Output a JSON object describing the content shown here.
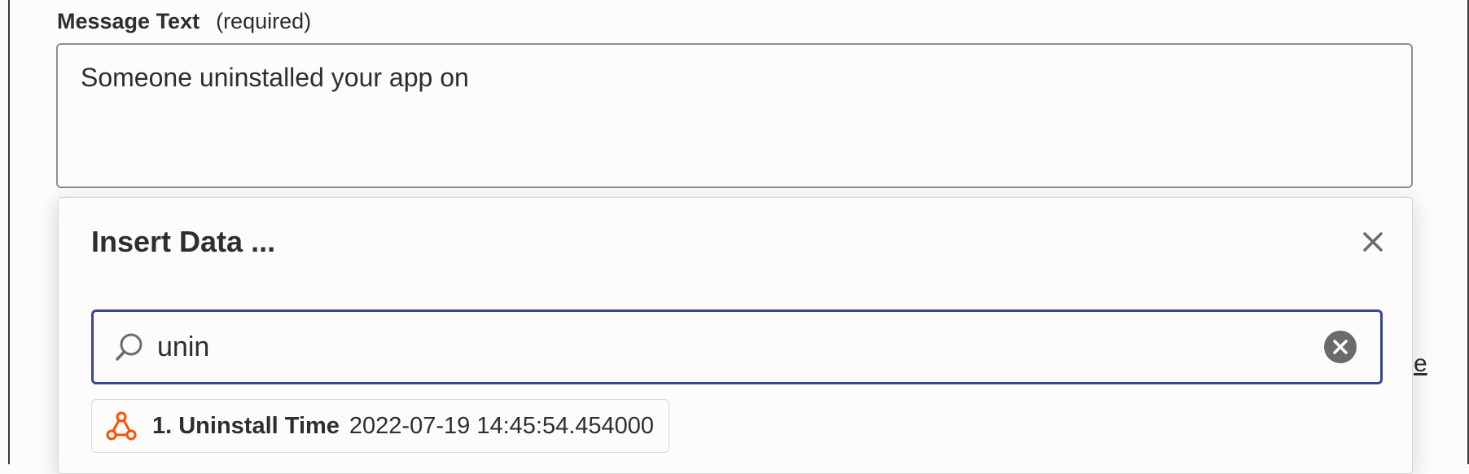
{
  "message_field": {
    "label": "Message Text",
    "required_tag": "(required)",
    "value": "Someone uninstalled your app on"
  },
  "insert_data": {
    "title": "Insert Data ...",
    "close_icon": "close-icon",
    "search": {
      "icon": "search-icon",
      "value": "unin",
      "clear_icon": "clear-circle-icon"
    },
    "results": [
      {
        "icon": "webhook-icon",
        "label": "1. Uninstall Time",
        "value": "2022-07-19 14:45:54.454000"
      }
    ]
  },
  "background_fragment": "e",
  "colors": {
    "focus_border": "#3d4592",
    "webhook_orange": "#ff4f00",
    "icon_gray": "#6b6b6b"
  }
}
